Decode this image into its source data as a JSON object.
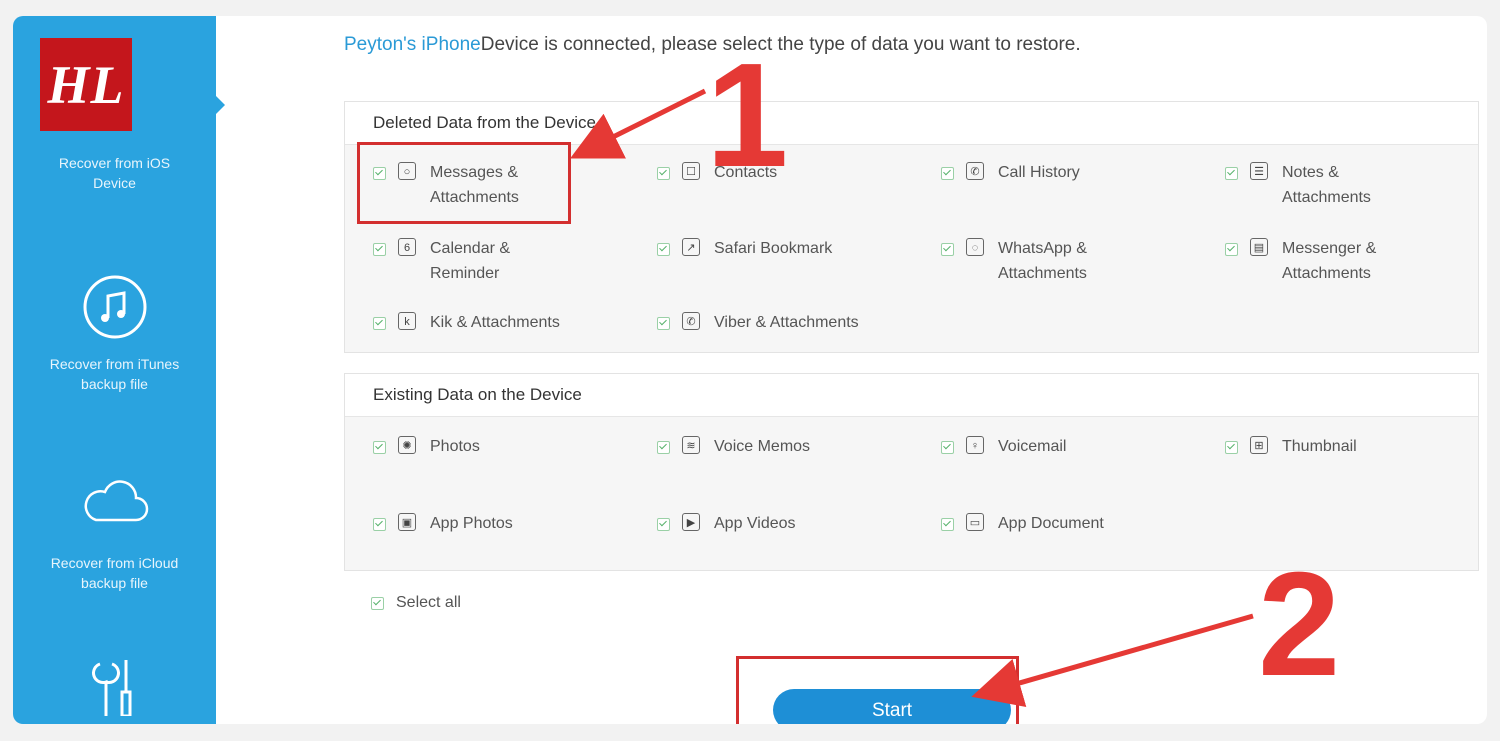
{
  "logo": {
    "text": "HL"
  },
  "sidebar": {
    "items": [
      {
        "label": "Recover from iOS Device",
        "icon": "phone-icon"
      },
      {
        "label": "Recover from iTunes backup file",
        "icon": "music-note-icon"
      },
      {
        "label": "Recover from iCloud backup file",
        "icon": "cloud-icon"
      },
      {
        "label": "",
        "icon": "tools-icon"
      }
    ]
  },
  "header": {
    "device_name": "Peyton's iPhone",
    "message": "Device is connected, please select the type of data you want to restore."
  },
  "deleted_section": {
    "title": "Deleted Data from the Device",
    "items": [
      {
        "label": "Messages & Attachments",
        "icon": "message-icon",
        "checked": true
      },
      {
        "label": "Contacts",
        "icon": "contacts-icon",
        "checked": true
      },
      {
        "label": "Call History",
        "icon": "phone-call-icon",
        "checked": true
      },
      {
        "label": "Notes & Attachments",
        "icon": "notes-icon",
        "checked": true
      },
      {
        "label": "Calendar & Reminder",
        "icon": "calendar-icon",
        "checked": true
      },
      {
        "label": "Safari Bookmark",
        "icon": "safari-icon",
        "checked": true
      },
      {
        "label": "WhatsApp & Attachments",
        "icon": "whatsapp-icon",
        "checked": true
      },
      {
        "label": "Messenger & Attachments",
        "icon": "messenger-icon",
        "checked": true
      },
      {
        "label": "Kik & Attachments",
        "icon": "kik-icon",
        "checked": true
      },
      {
        "label": "Viber & Attachments",
        "icon": "viber-icon",
        "checked": true
      }
    ]
  },
  "existing_section": {
    "title": "Existing Data on the Device",
    "items": [
      {
        "label": "Photos",
        "icon": "photos-icon",
        "checked": true
      },
      {
        "label": "Voice Memos",
        "icon": "voice-memo-icon",
        "checked": true
      },
      {
        "label": "Voicemail",
        "icon": "voicemail-icon",
        "checked": true
      },
      {
        "label": "Thumbnail",
        "icon": "thumbnail-icon",
        "checked": true
      },
      {
        "label": "App Photos",
        "icon": "app-photos-icon",
        "checked": true
      },
      {
        "label": "App Videos",
        "icon": "app-videos-icon",
        "checked": true
      },
      {
        "label": "App Document",
        "icon": "app-document-icon",
        "checked": true
      }
    ]
  },
  "select_all": {
    "label": "Select all",
    "checked": true
  },
  "start_button": {
    "label": "Start"
  },
  "annotations": {
    "step1": "1",
    "step2": "2"
  },
  "colors": {
    "sidebar": "#2aa3df",
    "accent": "#1e8fd6",
    "annotation": "#d32f2f"
  }
}
